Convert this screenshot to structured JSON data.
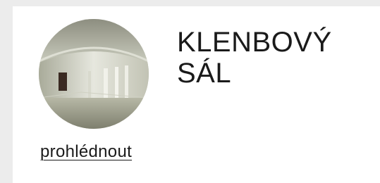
{
  "card": {
    "image_alt": "vaulted hall interior photo",
    "title_line1": "KLENBOVÝ",
    "title_line2": "SÁL",
    "link_label": "prohlédnout"
  },
  "colors": {
    "page_background": "#ececec",
    "card_background": "#ffffff",
    "text": "#1a1a1a"
  }
}
